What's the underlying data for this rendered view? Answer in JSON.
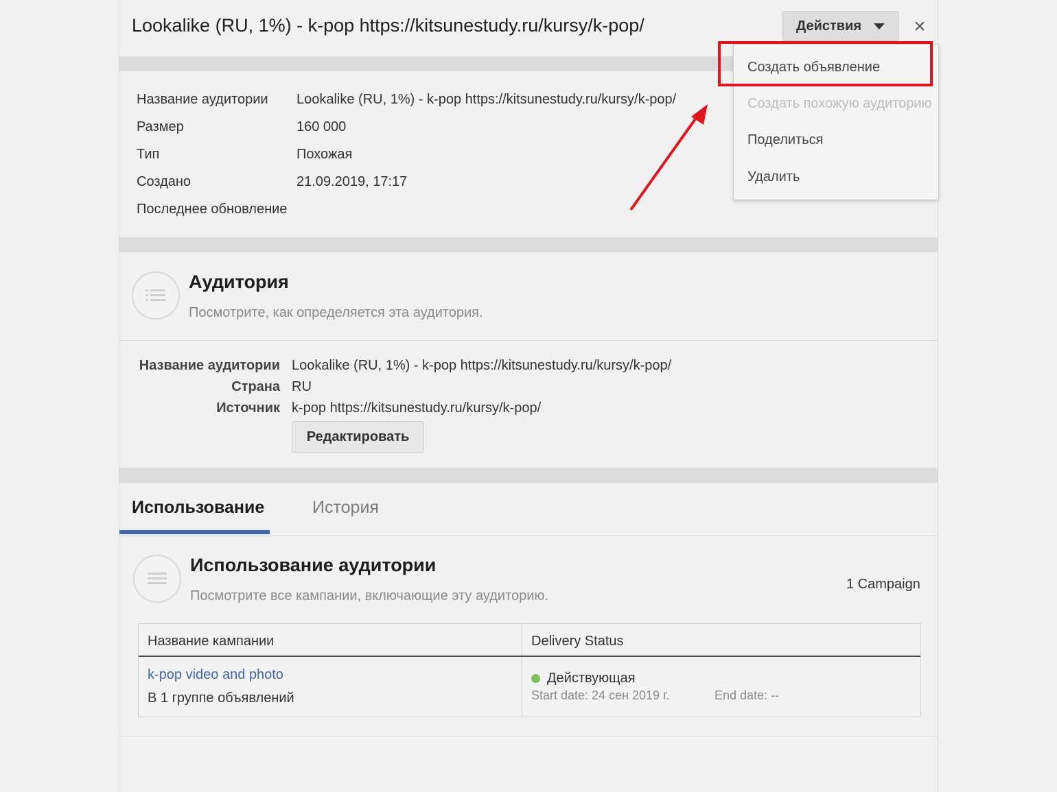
{
  "header": {
    "title": "Lookalike (RU, 1%) - k-pop https://kitsunestudy.ru/kursy/k-pop/",
    "actions_label": "Действия",
    "close_label": "×"
  },
  "dropdown": {
    "items": [
      {
        "label": "Создать объявление",
        "enabled": true
      },
      {
        "label": "Создать похожую аудиторию",
        "enabled": false
      },
      {
        "label": "Поделиться",
        "enabled": true
      },
      {
        "label": "Удалить",
        "enabled": true
      }
    ]
  },
  "summary": {
    "rows": [
      {
        "label": "Название аудитории",
        "value": "Lookalike (RU, 1%) - k-pop https://kitsunestudy.ru/kursy/k-pop/"
      },
      {
        "label": "Размер",
        "value": "160 000"
      },
      {
        "label": "Тип",
        "value": "Похожая"
      },
      {
        "label": "Создано",
        "value": "21.09.2019, 17:17"
      },
      {
        "label": "Последнее обновление",
        "value": ""
      }
    ]
  },
  "audience": {
    "title": "Аудитория",
    "subtitle": "Посмотрите, как определяется эта аудитория.",
    "rows": [
      {
        "label": "Название аудитории",
        "value": "Lookalike (RU, 1%) - k-pop https://kitsunestudy.ru/kursy/k-pop/"
      },
      {
        "label": "Страна",
        "value": "RU"
      },
      {
        "label": "Источник",
        "value": "k-pop https://kitsunestudy.ru/kursy/k-pop/"
      }
    ],
    "edit_label": "Редактировать"
  },
  "tabs": [
    {
      "label": "Использование",
      "active": true
    },
    {
      "label": "История",
      "active": false
    }
  ],
  "usage": {
    "title": "Использование аудитории",
    "subtitle": "Посмотрите все кампании, включающие эту аудиторию.",
    "count": "1 Campaign",
    "columns": [
      "Название кампании",
      "Delivery Status"
    ],
    "rows": [
      {
        "campaign": "k-pop video and photo",
        "groups": "В 1 группе объявлений",
        "status": "Действующая",
        "status_color": "#7cc35a",
        "start": "Start date: 24 сен 2019 г.",
        "end": "End date: --"
      }
    ]
  },
  "colors": {
    "accent": "#4267b2",
    "highlight": "#e0161f"
  }
}
